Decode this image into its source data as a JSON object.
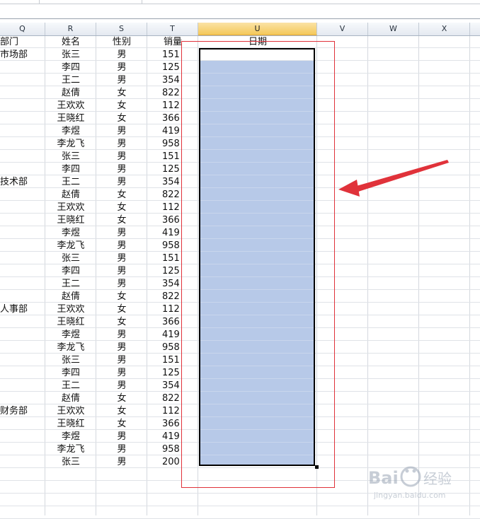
{
  "columns": [
    {
      "letter": "Q",
      "selected": false
    },
    {
      "letter": "R",
      "selected": false
    },
    {
      "letter": "S",
      "selected": false
    },
    {
      "letter": "T",
      "selected": false
    },
    {
      "letter": "U",
      "selected": true
    },
    {
      "letter": "V",
      "selected": false
    },
    {
      "letter": "W",
      "selected": false
    },
    {
      "letter": "X",
      "selected": false
    }
  ],
  "headers": {
    "dept": "部门",
    "name": "姓名",
    "gender": "性别",
    "sales": "销量",
    "date": "日期"
  },
  "rows": [
    {
      "dept": "市场部",
      "name": "张三",
      "gender": "男",
      "sales": "151"
    },
    {
      "dept": "",
      "name": "李四",
      "gender": "男",
      "sales": "125"
    },
    {
      "dept": "",
      "name": "王二",
      "gender": "男",
      "sales": "354"
    },
    {
      "dept": "",
      "name": "赵倩",
      "gender": "女",
      "sales": "822"
    },
    {
      "dept": "",
      "name": "王欢欢",
      "gender": "女",
      "sales": "112"
    },
    {
      "dept": "",
      "name": "王晓红",
      "gender": "女",
      "sales": "366"
    },
    {
      "dept": "",
      "name": "李煜",
      "gender": "男",
      "sales": "419"
    },
    {
      "dept": "",
      "name": "李龙飞",
      "gender": "男",
      "sales": "958"
    },
    {
      "dept": "",
      "name": "张三",
      "gender": "男",
      "sales": "151"
    },
    {
      "dept": "",
      "name": "李四",
      "gender": "男",
      "sales": "125"
    },
    {
      "dept": "技术部",
      "name": "王二",
      "gender": "男",
      "sales": "354"
    },
    {
      "dept": "",
      "name": "赵倩",
      "gender": "女",
      "sales": "822"
    },
    {
      "dept": "",
      "name": "王欢欢",
      "gender": "女",
      "sales": "112"
    },
    {
      "dept": "",
      "name": "王晓红",
      "gender": "女",
      "sales": "366"
    },
    {
      "dept": "",
      "name": "李煜",
      "gender": "男",
      "sales": "419"
    },
    {
      "dept": "",
      "name": "李龙飞",
      "gender": "男",
      "sales": "958"
    },
    {
      "dept": "",
      "name": "张三",
      "gender": "男",
      "sales": "151"
    },
    {
      "dept": "",
      "name": "李四",
      "gender": "男",
      "sales": "125"
    },
    {
      "dept": "",
      "name": "王二",
      "gender": "男",
      "sales": "354"
    },
    {
      "dept": "",
      "name": "赵倩",
      "gender": "女",
      "sales": "822"
    },
    {
      "dept": "人事部",
      "name": "王欢欢",
      "gender": "女",
      "sales": "112"
    },
    {
      "dept": "",
      "name": "王晓红",
      "gender": "女",
      "sales": "366"
    },
    {
      "dept": "",
      "name": "李煜",
      "gender": "男",
      "sales": "419"
    },
    {
      "dept": "",
      "name": "李龙飞",
      "gender": "男",
      "sales": "958"
    },
    {
      "dept": "",
      "name": "张三",
      "gender": "男",
      "sales": "151"
    },
    {
      "dept": "",
      "name": "李四",
      "gender": "男",
      "sales": "125"
    },
    {
      "dept": "",
      "name": "王二",
      "gender": "男",
      "sales": "354"
    },
    {
      "dept": "",
      "name": "赵倩",
      "gender": "女",
      "sales": "822"
    },
    {
      "dept": "财务部",
      "name": "王欢欢",
      "gender": "女",
      "sales": "112"
    },
    {
      "dept": "",
      "name": "王晓红",
      "gender": "女",
      "sales": "366"
    },
    {
      "dept": "",
      "name": "李煜",
      "gender": "男",
      "sales": "419"
    },
    {
      "dept": "",
      "name": "李龙飞",
      "gender": "男",
      "sales": "958"
    },
    {
      "dept": "",
      "name": "张三",
      "gender": "男",
      "sales": "200"
    }
  ],
  "colors": {
    "selection_fill": "#b7c9e8",
    "annotation_red": "#e0323a",
    "header_selected": "#f4c859"
  },
  "watermark": {
    "text": "Bai 经验",
    "url": "jingyan.baidu.com"
  }
}
